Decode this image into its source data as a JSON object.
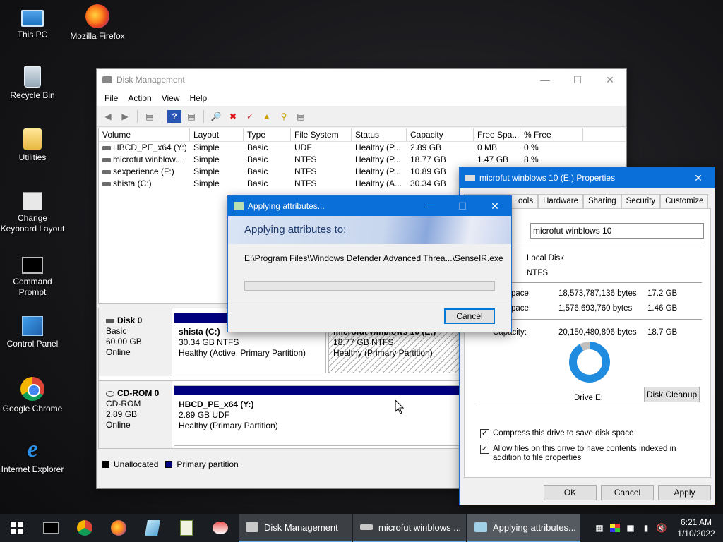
{
  "desktop": {
    "icons": [
      {
        "label": "This PC",
        "icon": "pc-icon"
      },
      {
        "label": "Mozilla Firefox",
        "icon": "firefox-icon"
      },
      {
        "label": "Recycle Bin",
        "icon": "recycle-bin-icon"
      },
      {
        "label": "Utilities",
        "icon": "folder-icon"
      },
      {
        "label": "Change Keyboard Layout",
        "icon": "keyboard-icon"
      },
      {
        "label": "Command Prompt",
        "icon": "cmd-icon"
      },
      {
        "label": "Control Panel",
        "icon": "control-panel-icon"
      },
      {
        "label": "Google Chrome",
        "icon": "chrome-icon"
      },
      {
        "label": "Internet Explorer",
        "icon": "ie-icon"
      }
    ]
  },
  "disk_mgmt": {
    "title": "Disk Management",
    "menu": [
      "File",
      "Action",
      "View",
      "Help"
    ],
    "columns": [
      "Volume",
      "Layout",
      "Type",
      "File System",
      "Status",
      "Capacity",
      "Free Spa...",
      "% Free"
    ],
    "volumes": [
      {
        "volume": "HBCD_PE_x64 (Y:)",
        "layout": "Simple",
        "type": "Basic",
        "fs": "UDF",
        "status": "Healthy (P...",
        "capacity": "2.89 GB",
        "free": "0 MB",
        "pct": "0 %"
      },
      {
        "volume": "microfut winblow...",
        "layout": "Simple",
        "type": "Basic",
        "fs": "NTFS",
        "status": "Healthy (P...",
        "capacity": "18.77 GB",
        "free": "1.47 GB",
        "pct": "8 %"
      },
      {
        "volume": "sexperience (F:)",
        "layout": "Simple",
        "type": "Basic",
        "fs": "NTFS",
        "status": "Healthy (P...",
        "capacity": "10.89 GB",
        "free": "",
        "pct": ""
      },
      {
        "volume": "shista (C:)",
        "layout": "Simple",
        "type": "Basic",
        "fs": "NTFS",
        "status": "Healthy (A...",
        "capacity": "30.34 GB",
        "free": "",
        "pct": ""
      }
    ],
    "disks": [
      {
        "name": "Disk 0",
        "kind": "Basic",
        "size": "60.00 GB",
        "state": "Online",
        "parts": [
          {
            "title": "shista  (C:)",
            "size": "30.34 GB NTFS",
            "status": "Healthy (Active, Primary Partition)"
          },
          {
            "title": "microfut winblows 10  (E:)",
            "size": "18.77 GB NTFS",
            "status": "Healthy (Primary Partition)"
          }
        ]
      },
      {
        "name": "CD-ROM 0",
        "kind": "CD-ROM",
        "size": "2.89 GB",
        "state": "Online",
        "parts": [
          {
            "title": "HBCD_PE_x64  (Y:)",
            "size": "2.89 GB UDF",
            "status": "Healthy (Primary Partition)"
          }
        ]
      }
    ],
    "legend": {
      "unallocated": "Unallocated",
      "primary": "Primary partition"
    },
    "colors": {
      "primary": "#00007e",
      "unallocated": "#000000"
    }
  },
  "props": {
    "title": "microfut winblows 10 (E:) Properties",
    "tabs": [
      "Tools",
      "Hardware",
      "Sharing",
      "Security",
      "Customize"
    ],
    "tabs_visible": [
      "ools",
      "Hardware",
      "Sharing",
      "Security",
      "Customize"
    ],
    "name_value": "microfut winblows 10",
    "type": "Local Disk",
    "fs": "NTFS",
    "used_label": "pace:",
    "used_bytes": "18,573,787,136 bytes",
    "used_gb": "17.2 GB",
    "free_label": "pace:",
    "free_bytes": "1,576,693,760 bytes",
    "free_gb": "1.46 GB",
    "cap_label": "Capacity:",
    "cap_bytes": "20,150,480,896 bytes",
    "cap_gb": "18.7 GB",
    "drive_label": "Drive E:",
    "cleanup": "Disk Cleanup",
    "compress": "Compress this drive to save disk space",
    "index": "Allow files on this drive to have contents indexed in addition to file properties",
    "ok": "OK",
    "cancel": "Cancel",
    "apply": "Apply",
    "used_fraction": 0.92,
    "colors": {
      "used": "#1f8ce0",
      "free": "#c0c0c0"
    }
  },
  "apply": {
    "title": "Applying attributes...",
    "heading": "Applying attributes to:",
    "path": "E:\\Program Files\\Windows Defender Advanced Threa...\\SenseIR.exe",
    "progress": 0,
    "cancel": "Cancel"
  },
  "taskbar": {
    "windows": [
      "Disk Management",
      "microfut winblows ...",
      "Applying attributes..."
    ],
    "time": "6:21 AM",
    "date": "1/10/2022"
  }
}
